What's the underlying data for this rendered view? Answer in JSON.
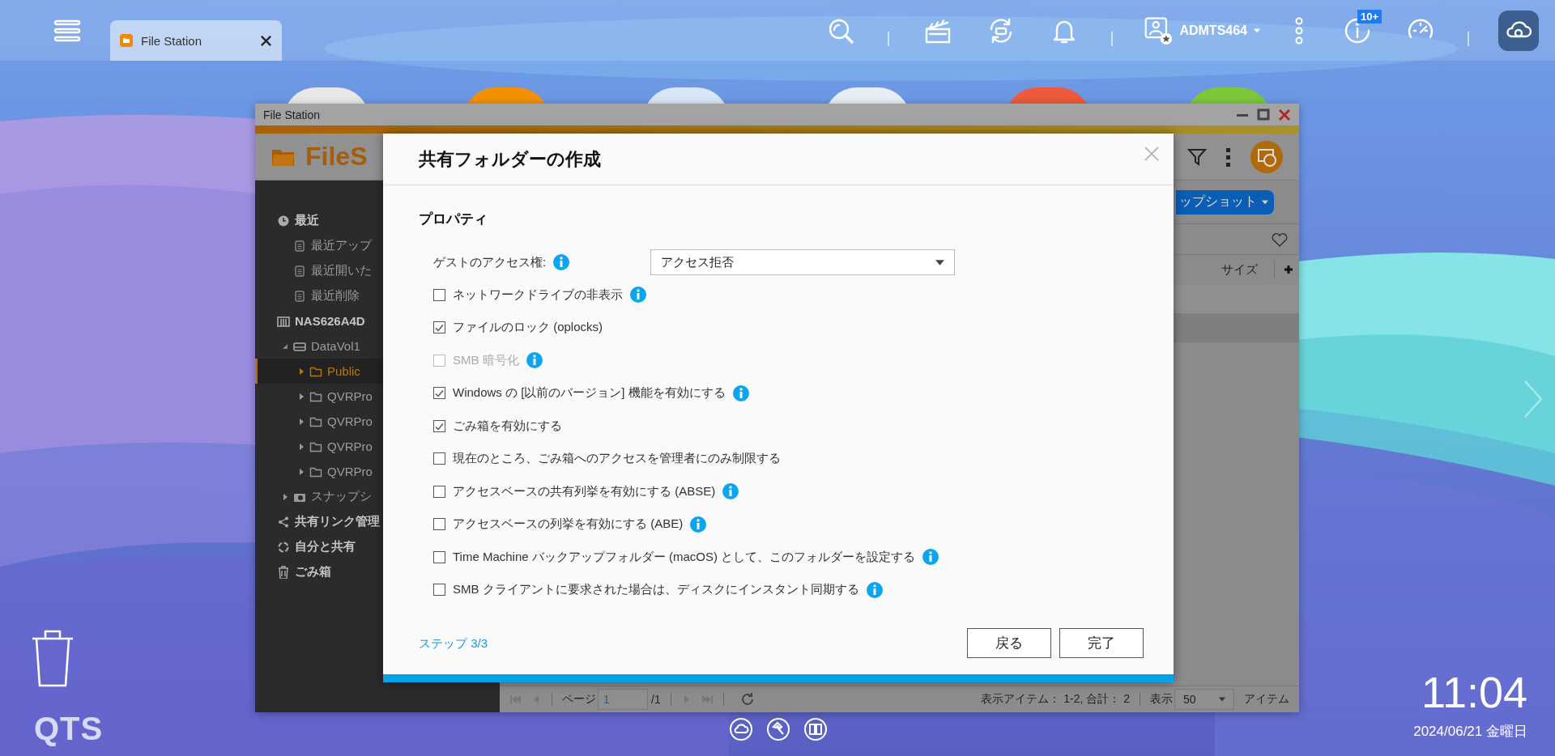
{
  "taskbar": {
    "tabs": [
      {
        "label": "File Station",
        "selected": true
      }
    ],
    "user": "ADMTS464",
    "notification_badge": "10+"
  },
  "window": {
    "title": "File Station",
    "app_name": "FileS",
    "sidebar": [
      {
        "label": "最近",
        "kind": "clock",
        "selected": false,
        "children": [
          {
            "label": "最近アップ",
            "kind": "doc",
            "selected": false
          },
          {
            "label": "最近開いた",
            "kind": "doc",
            "selected": false
          },
          {
            "label": "最近削除",
            "kind": "doc",
            "selected": false
          }
        ]
      },
      {
        "label": "NAS626A4D",
        "kind": "nas",
        "selected": false,
        "children": [
          {
            "label": "DataVol1",
            "kind": "drive",
            "selected": false,
            "expanded": true,
            "children": [
              {
                "label": "Public",
                "kind": "folder",
                "selected": true,
                "expanded": false
              },
              {
                "label": "QVRPro",
                "kind": "folder",
                "selected": false,
                "expanded": false
              },
              {
                "label": "QVRPro",
                "kind": "folder",
                "selected": false,
                "expanded": false
              },
              {
                "label": "QVRPro",
                "kind": "folder",
                "selected": false,
                "expanded": false
              },
              {
                "label": "QVRPro",
                "kind": "folder",
                "selected": false,
                "expanded": false
              }
            ]
          },
          {
            "label": "スナップシ",
            "kind": "snapshot",
            "selected": false,
            "expanded": false
          }
        ]
      },
      {
        "label": "共有リンク管理",
        "kind": "share",
        "selected": false
      },
      {
        "label": "自分と共有",
        "kind": "shared",
        "selected": false
      },
      {
        "label": "ごみ箱",
        "kind": "trash",
        "selected": false
      }
    ],
    "snapshot_button": "ップショット",
    "columns": [
      "サイズ"
    ],
    "rows": [
      {
        "selected": false
      },
      {
        "selected": true
      }
    ],
    "pagination": {
      "page_label": "ページ",
      "page": "1",
      "total": "/1",
      "summary": "表示アイテム： 1-2, 合計： 2",
      "show_label": "表示",
      "per_page": "50",
      "unit": "アイテム"
    }
  },
  "dialog": {
    "title": "共有フォルダーの作成",
    "section": "プロパティ",
    "guest_access": {
      "label": "ゲストのアクセス権:",
      "info": true,
      "value": "アクセス拒否"
    },
    "options": [
      {
        "label": "ネットワークドライブの非表示",
        "checked": false,
        "disabled": false,
        "info": true
      },
      {
        "label": "ファイルのロック (oplocks)",
        "checked": true,
        "disabled": false,
        "info": false
      },
      {
        "label": "SMB 暗号化",
        "checked": false,
        "disabled": true,
        "info": true
      },
      {
        "label": "Windows の [以前のバージョン] 機能を有効にする",
        "checked": true,
        "disabled": false,
        "info": true
      },
      {
        "label": "ごみ箱を有効にする",
        "checked": true,
        "disabled": false,
        "info": false
      },
      {
        "label": "現在のところ、ごみ箱へのアクセスを管理者にのみ制限する",
        "checked": false,
        "disabled": false,
        "info": false
      },
      {
        "label": "アクセスベースの共有列挙を有効にする (ABSE)",
        "checked": false,
        "disabled": false,
        "info": true
      },
      {
        "label": "アクセスベースの列挙を有効にする (ABE)",
        "checked": false,
        "disabled": false,
        "info": true
      },
      {
        "label": "Time Machine バックアップフォルダー (macOS) として、このフォルダーを設定する",
        "checked": false,
        "disabled": false,
        "info": true
      },
      {
        "label": "SMB クライアントに要求された場合は、ディスクにインスタント同期する",
        "checked": false,
        "disabled": false,
        "info": true
      }
    ],
    "step": "ステップ 3/3",
    "buttons": [
      "戻る",
      "完了"
    ]
  },
  "desktop": {
    "logo": "QTS",
    "time": "11:04",
    "date": "2024/06/21 金曜日"
  }
}
